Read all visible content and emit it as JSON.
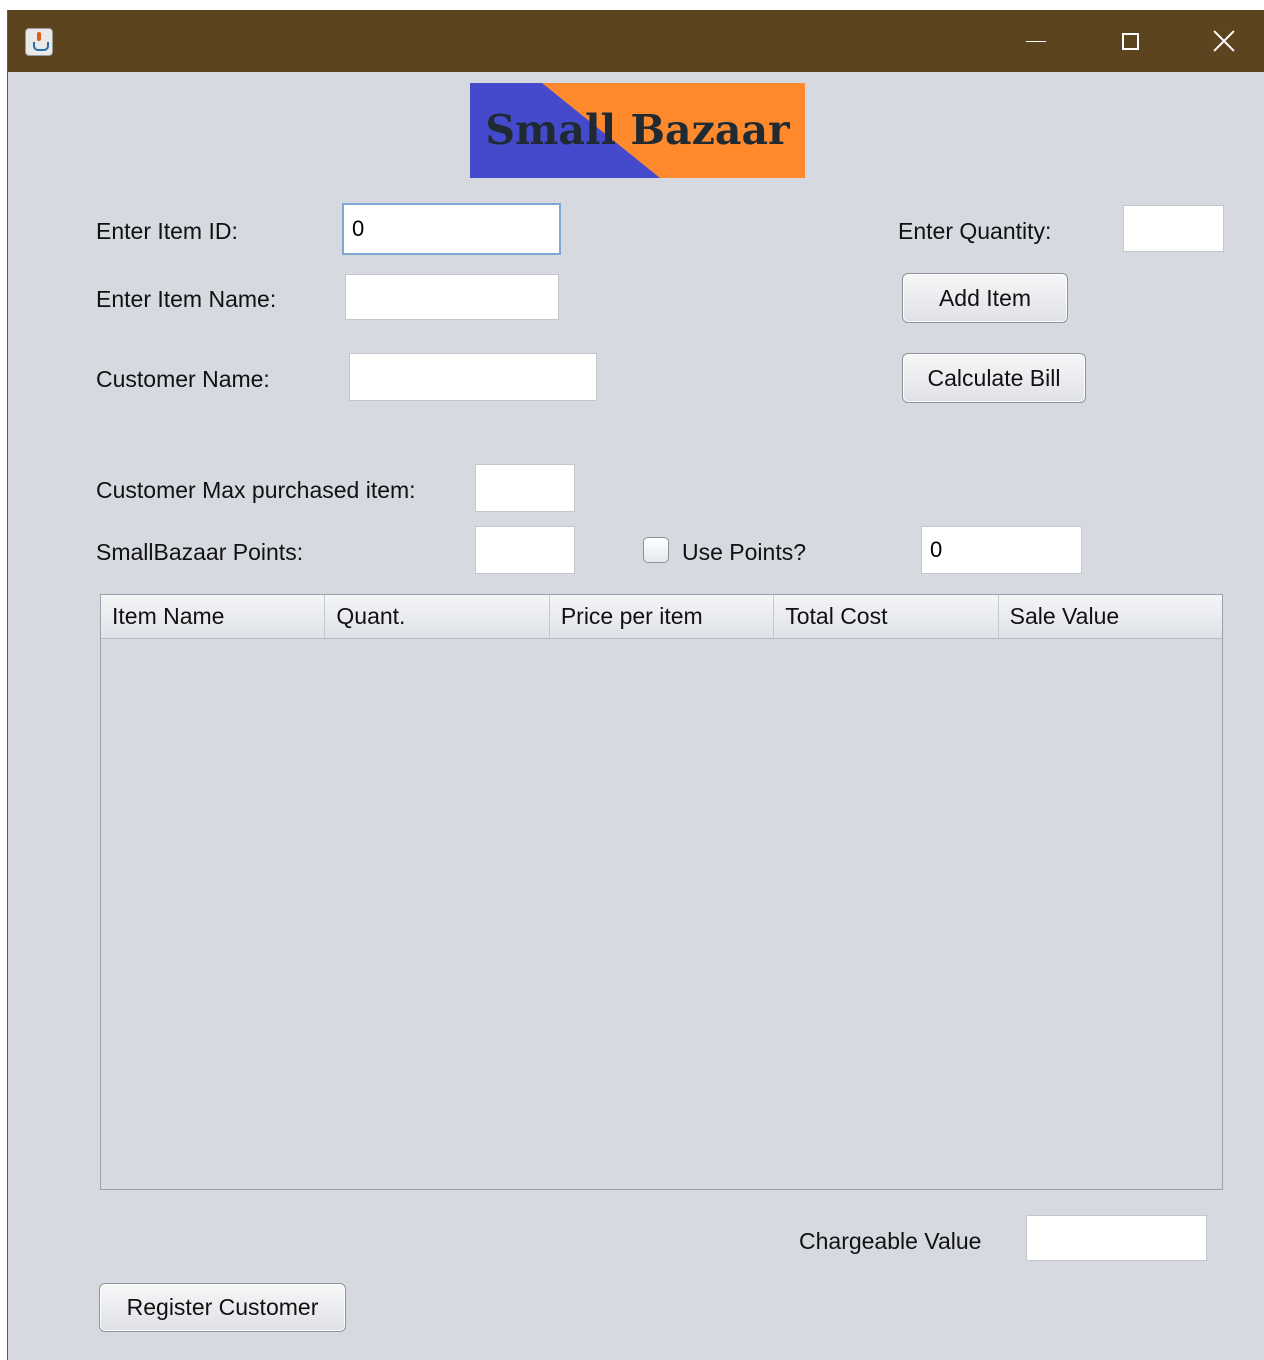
{
  "window": {
    "controls": [
      "minimize",
      "maximize",
      "close"
    ],
    "icon": "java-app-icon"
  },
  "logo": {
    "text": "Small Bazaar",
    "colors": {
      "left": "#454acc",
      "right": "#ff8a2e"
    }
  },
  "form": {
    "item_id_label": "Enter Item ID:",
    "item_id_value": "0",
    "item_name_label": "Enter Item Name:",
    "item_name_value": "",
    "customer_name_label": "Customer Name:",
    "customer_name_value": "",
    "quantity_label": "Enter Quantity:",
    "quantity_value": "",
    "max_purchased_label": "Customer Max purchased item:",
    "max_purchased_value": "",
    "points_label": "SmallBazaar Points:",
    "points_value": "",
    "use_points_label": "Use Points?",
    "use_points_checked": false,
    "use_points_value": "0"
  },
  "buttons": {
    "add_item": "Add Item",
    "calculate_bill": "Calculate Bill",
    "register_customer": "Register Customer"
  },
  "table": {
    "columns": [
      "Item Name",
      "Quant.",
      "Price per item",
      "Total Cost",
      "Sale Value"
    ],
    "rows": []
  },
  "footer": {
    "chargeable_label": "Chargeable Value",
    "chargeable_value": ""
  }
}
